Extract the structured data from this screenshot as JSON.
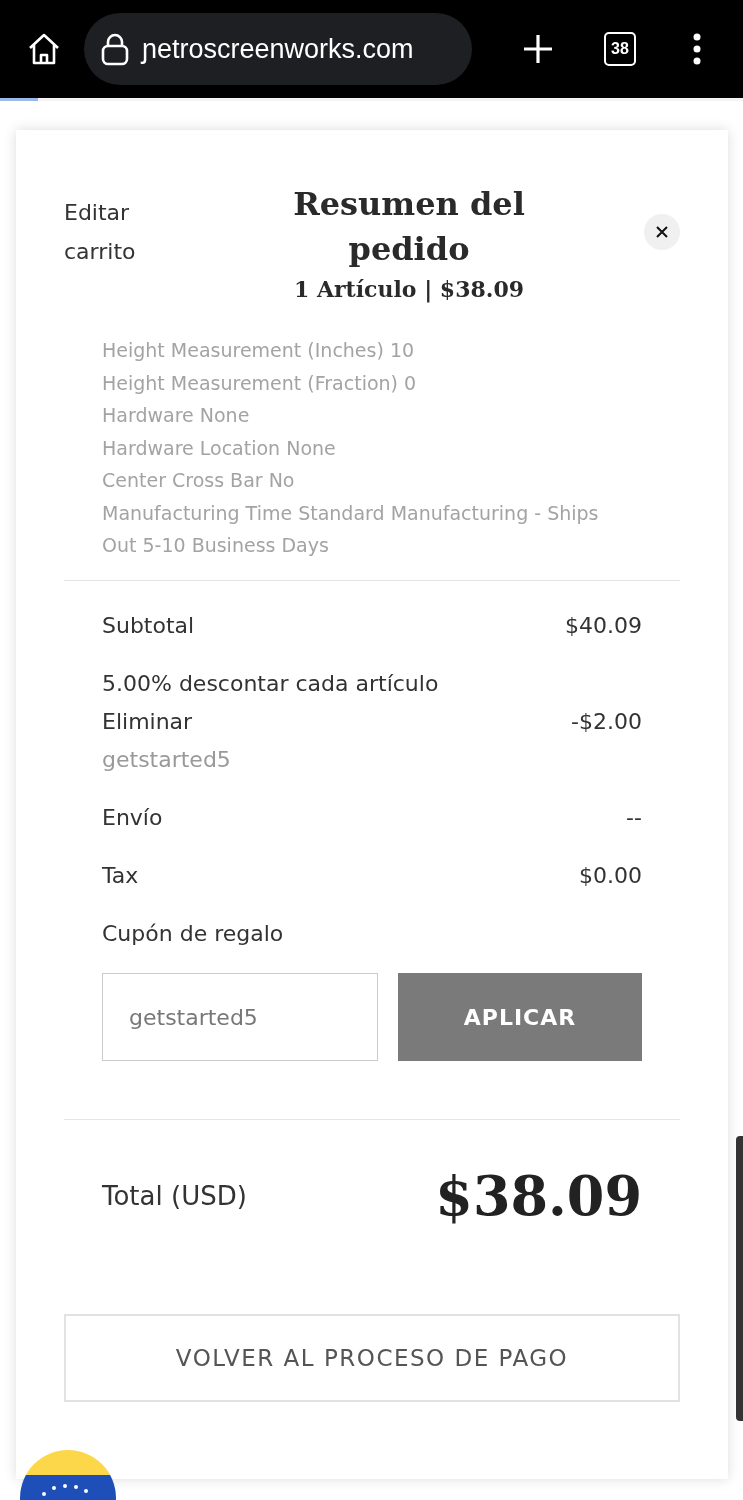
{
  "browser": {
    "url": "ɲetroscreenworks.com",
    "tab_count": "38"
  },
  "header": {
    "edit_link": "Editar carrito",
    "title": "Resumen del pedido",
    "subtitle": "1 Artículo | $38.09"
  },
  "item_details": [
    "Height Measurement (Inches) 10",
    "Height Measurement (Fraction) 0",
    "Hardware None",
    "Hardware Location None",
    "Center Cross Bar No",
    "Manufacturing Time Standard Manufacturing - Ships Out 5-10 Business Days"
  ],
  "summary": [
    {
      "kind": "line",
      "label": "Subtotal",
      "value": "$40.09"
    },
    {
      "kind": "discount",
      "label": "5.00% descontar cada artículo",
      "remove": "Eliminar",
      "code": "getstarted5",
      "value": "-$2.00"
    },
    {
      "kind": "line",
      "label": "Envío",
      "value": "--"
    },
    {
      "kind": "line",
      "label": "Tax",
      "value": "$0.00"
    }
  ],
  "coupon": {
    "label": "Cupón de regalo",
    "value": "getstarted5",
    "button": "APLICAR"
  },
  "total": {
    "label": "Total (USD)",
    "value": "$38.09"
  },
  "checkout_button": "VOLVER AL PROCESO DE PAGO"
}
